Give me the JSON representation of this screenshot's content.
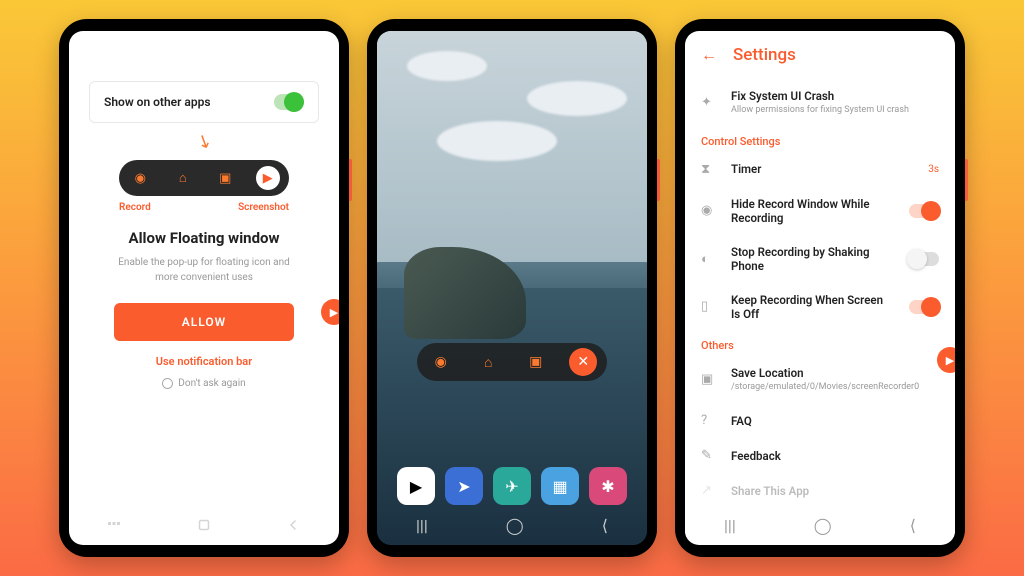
{
  "screen1": {
    "card_title": "Show on other apps",
    "pill_labels": {
      "record": "Record",
      "screenshot": "Screenshot"
    },
    "heading": "Allow Floating window",
    "subtitle": "Enable the pop-up for floating icon and more convenient uses",
    "allow_button": "ALLOW",
    "use_notification": "Use notification bar",
    "dont_ask": "Don't ask again"
  },
  "screen2": {
    "dock_apps": [
      "play-store",
      "send-blue",
      "send-teal",
      "qr-code",
      "asterisk"
    ]
  },
  "screen3": {
    "title": "Settings",
    "fix_crash": {
      "title": "Fix System UI Crash",
      "desc": "Allow permissions for fixing System UI crash"
    },
    "section_control": "Control Settings",
    "timer": {
      "label": "Timer",
      "value": "3s"
    },
    "hide_window": "Hide Record Window While Recording",
    "shake_stop": "Stop Recording by Shaking Phone",
    "keep_recording": "Keep Recording When Screen Is Off",
    "section_others": "Others",
    "save_location": {
      "title": "Save Location",
      "path": "/storage/emulated/0/Movies/screenRecorder0"
    },
    "faq": "FAQ",
    "feedback": "Feedback",
    "share": "Share This App"
  }
}
